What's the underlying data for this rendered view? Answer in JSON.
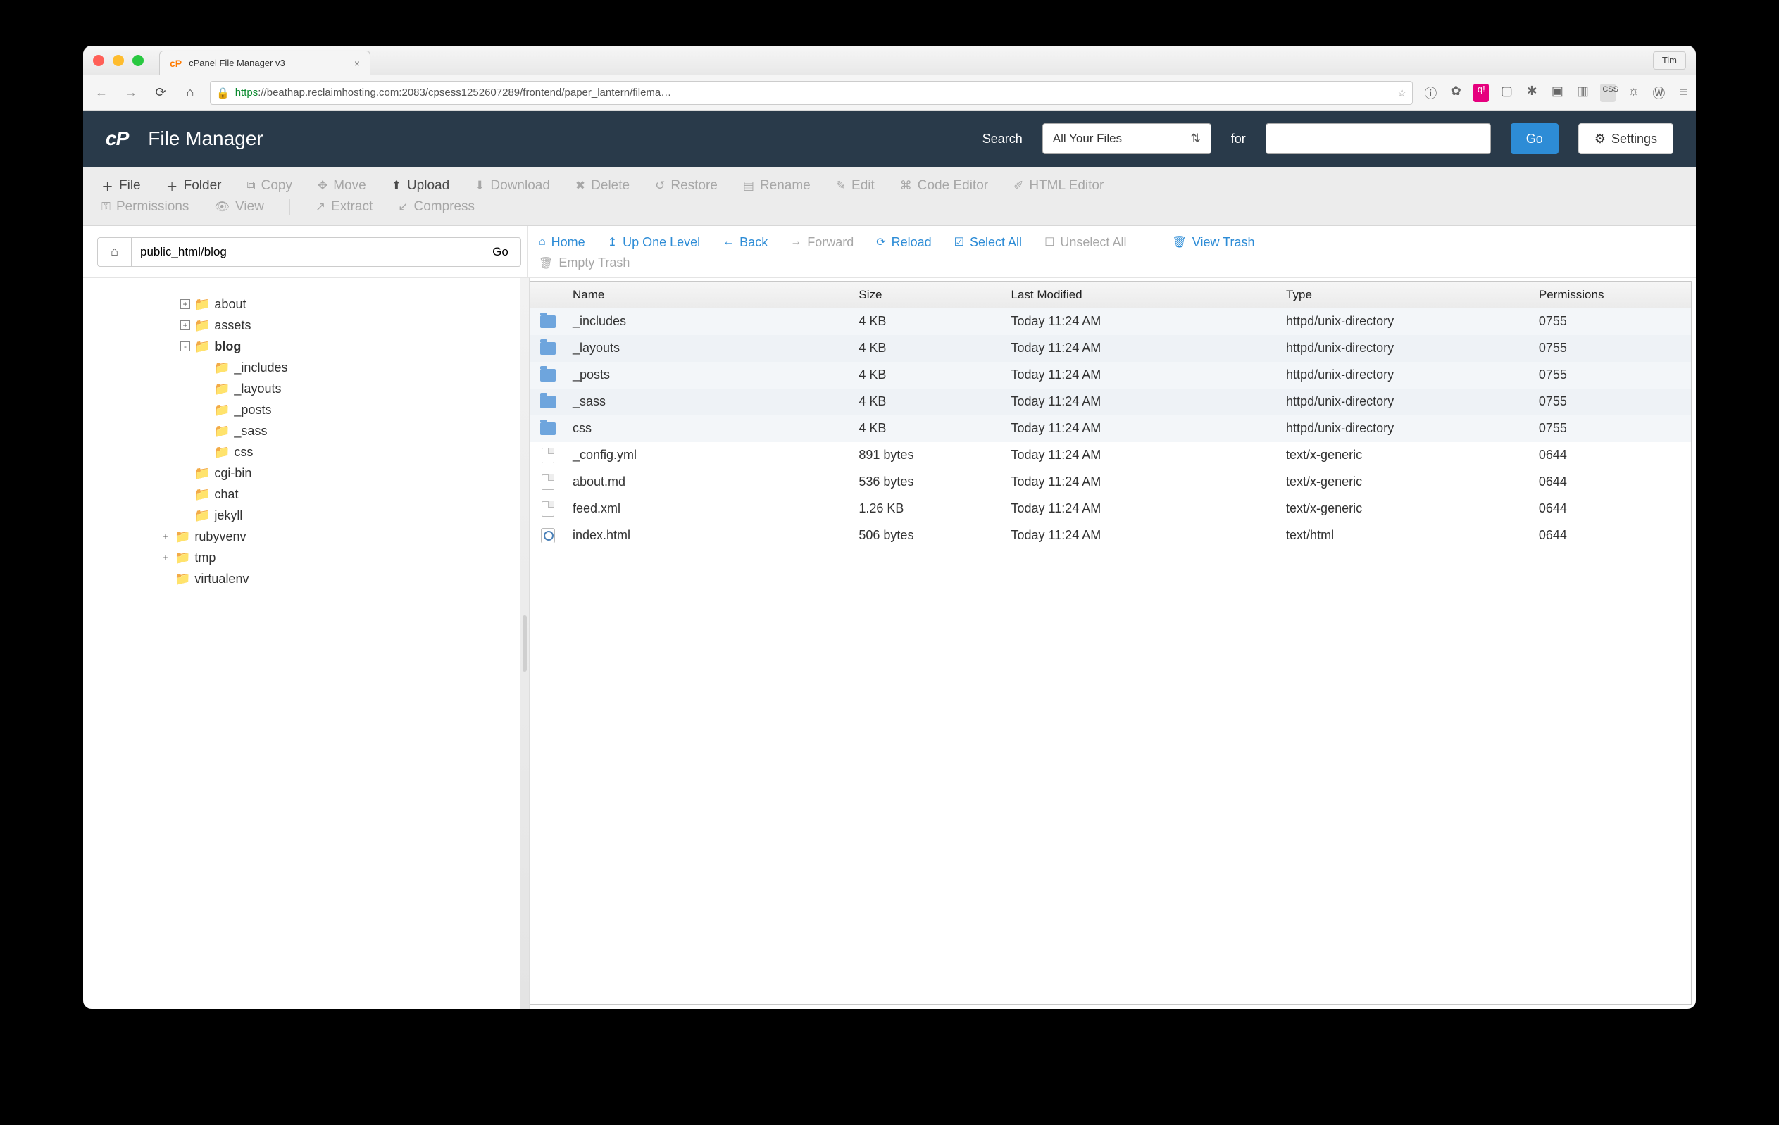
{
  "browser": {
    "tab_title": "cPanel File Manager v3",
    "profile_name": "Tim",
    "url_protocol": "https",
    "url_rest": "://beathap.reclaimhosting.com:2083/cpsess1252607289/frontend/paper_lantern/filema…"
  },
  "header": {
    "logo_text": "cP",
    "title": "File Manager",
    "search_label": "Search",
    "search_scope": "All Your Files",
    "for_label": "for",
    "search_value": "",
    "go_label": "Go",
    "settings_label": "Settings"
  },
  "toolbar": {
    "file": "File",
    "folder": "Folder",
    "copy": "Copy",
    "move": "Move",
    "upload": "Upload",
    "download": "Download",
    "delete": "Delete",
    "restore": "Restore",
    "rename": "Rename",
    "edit": "Edit",
    "code_editor": "Code Editor",
    "html_editor": "HTML Editor",
    "permissions": "Permissions",
    "view": "View",
    "extract": "Extract",
    "compress": "Compress"
  },
  "path": {
    "value": "public_html/blog",
    "go": "Go"
  },
  "nav_actions": {
    "home": "Home",
    "up": "Up One Level",
    "back": "Back",
    "forward": "Forward",
    "reload": "Reload",
    "select_all": "Select All",
    "unselect_all": "Unselect All",
    "view_trash": "View Trash",
    "empty_trash": "Empty Trash"
  },
  "tree": [
    {
      "level": 0,
      "name": "about",
      "toggle": "+",
      "bold": false
    },
    {
      "level": 0,
      "name": "assets",
      "toggle": "+",
      "bold": false
    },
    {
      "level": 0,
      "name": "blog",
      "toggle": "-",
      "bold": true
    },
    {
      "level": 1,
      "name": "_includes",
      "toggle": "",
      "bold": false
    },
    {
      "level": 1,
      "name": "_layouts",
      "toggle": "",
      "bold": false
    },
    {
      "level": 1,
      "name": "_posts",
      "toggle": "",
      "bold": false
    },
    {
      "level": 1,
      "name": "_sass",
      "toggle": "",
      "bold": false
    },
    {
      "level": 1,
      "name": "css",
      "toggle": "",
      "bold": false
    },
    {
      "level": 0,
      "name": "cgi-bin",
      "toggle": "",
      "bold": false
    },
    {
      "level": 0,
      "name": "chat",
      "toggle": "",
      "bold": false
    },
    {
      "level": 0,
      "name": "jekyll",
      "toggle": "",
      "bold": false
    },
    {
      "level": -1,
      "name": "rubyvenv",
      "toggle": "+",
      "bold": false
    },
    {
      "level": -1,
      "name": "tmp",
      "toggle": "+",
      "bold": false
    },
    {
      "level": -1,
      "name": "virtualenv",
      "toggle": "",
      "bold": false
    }
  ],
  "file_table": {
    "columns": {
      "name": "Name",
      "size": "Size",
      "modified": "Last Modified",
      "type": "Type",
      "permissions": "Permissions"
    },
    "rows": [
      {
        "kind": "dir",
        "name": "_includes",
        "size": "4 KB",
        "modified": "Today 11:24 AM",
        "type": "httpd/unix-directory",
        "perm": "0755"
      },
      {
        "kind": "dir",
        "name": "_layouts",
        "size": "4 KB",
        "modified": "Today 11:24 AM",
        "type": "httpd/unix-directory",
        "perm": "0755"
      },
      {
        "kind": "dir",
        "name": "_posts",
        "size": "4 KB",
        "modified": "Today 11:24 AM",
        "type": "httpd/unix-directory",
        "perm": "0755"
      },
      {
        "kind": "dir",
        "name": "_sass",
        "size": "4 KB",
        "modified": "Today 11:24 AM",
        "type": "httpd/unix-directory",
        "perm": "0755"
      },
      {
        "kind": "dir",
        "name": "css",
        "size": "4 KB",
        "modified": "Today 11:24 AM",
        "type": "httpd/unix-directory",
        "perm": "0755"
      },
      {
        "kind": "file",
        "name": "_config.yml",
        "size": "891 bytes",
        "modified": "Today 11:24 AM",
        "type": "text/x-generic",
        "perm": "0644"
      },
      {
        "kind": "file",
        "name": "about.md",
        "size": "536 bytes",
        "modified": "Today 11:24 AM",
        "type": "text/x-generic",
        "perm": "0644"
      },
      {
        "kind": "file",
        "name": "feed.xml",
        "size": "1.26 KB",
        "modified": "Today 11:24 AM",
        "type": "text/x-generic",
        "perm": "0644"
      },
      {
        "kind": "html",
        "name": "index.html",
        "size": "506 bytes",
        "modified": "Today 11:24 AM",
        "type": "text/html",
        "perm": "0644"
      }
    ]
  }
}
